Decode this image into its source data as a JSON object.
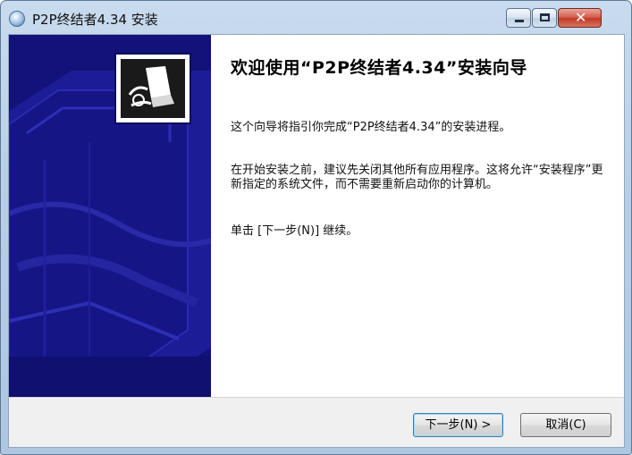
{
  "window": {
    "title": "P2P终结者4.34 安装",
    "icon": "installer-globe-icon"
  },
  "caption_buttons": {
    "minimize_icon": "minimize-icon",
    "maximize_icon": "maximize-icon",
    "close_icon": "close-icon",
    "close_glyph": "✕",
    "close_color": "#c23a27"
  },
  "banner": {
    "logo_icon": "installer-logo-icon",
    "background_color": "#12127a"
  },
  "content": {
    "title": "欢迎使用“P2P终结者4.34”安装向导",
    "paragraphs": [
      "这个向导将指引你完成“P2P终结者4.34”的安装进程。",
      "在开始安装之前，建议先关闭其他所有应用程序。这将允许“安装程序”更新指定的系统文件，而不需要重新启动你的计算机。",
      "单击 [下一步(N)] 继续。"
    ]
  },
  "buttons": {
    "next_label": "下一步(N) >",
    "cancel_label": "取消(C)"
  }
}
